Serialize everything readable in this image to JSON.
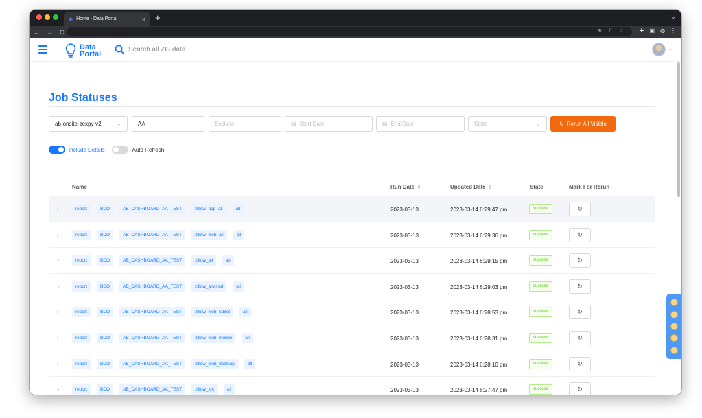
{
  "browser": {
    "tab_title": "Home - Data Portal",
    "new_tab": "+",
    "close": "×"
  },
  "app": {
    "logo_line1": "Data",
    "logo_line2": "Portal",
    "search_placeholder": "Search all ZG data"
  },
  "page": {
    "title": "Job Statuses"
  },
  "filters": {
    "experiment": "ab-onsite-zexpy-v2",
    "include": "AA",
    "exclude_placeholder": "Exclude",
    "start_placeholder": "Start Date",
    "end_placeholder": "End Date",
    "state_placeholder": "State",
    "rerun_all": "Rerun All Visible"
  },
  "toggles": {
    "include_details": "Include Details",
    "include_details_on": true,
    "auto_refresh": "Auto Refresh",
    "auto_refresh_on": false
  },
  "table": {
    "headers": {
      "name": "Name",
      "run_date": "Run Date",
      "updated_date": "Updated Date",
      "state": "State",
      "mark": "Mark For Rerun"
    },
    "rows": [
      {
        "t1": "report",
        "t2": "BDO",
        "t3": "AB_DASHBOARD_AA_TEST",
        "t4": "zillow_app_all",
        "t5": "all",
        "run": "2023-03-13",
        "updated": "2023-03-14 6:29:47 pm",
        "state": "success"
      },
      {
        "t1": "report",
        "t2": "BDO",
        "t3": "AB_DASHBOARD_AA_TEST",
        "t4": "zillow_web_all",
        "t5": "all",
        "run": "2023-03-13",
        "updated": "2023-03-14 6:29:36 pm",
        "state": "success"
      },
      {
        "t1": "report",
        "t2": "BDO",
        "t3": "AB_DASHBOARD_AA_TEST",
        "t4": "zillow_all",
        "t5": "all",
        "run": "2023-03-13",
        "updated": "2023-03-14 6:29:15 pm",
        "state": "success"
      },
      {
        "t1": "report",
        "t2": "BDO",
        "t3": "AB_DASHBOARD_AA_TEST",
        "t4": "zillow_android",
        "t5": "all",
        "run": "2023-03-13",
        "updated": "2023-03-14 6:29:03 pm",
        "state": "success"
      },
      {
        "t1": "report",
        "t2": "BDO",
        "t3": "AB_DASHBOARD_AA_TEST",
        "t4": "zillow_web_tablet",
        "t5": "all",
        "run": "2023-03-13",
        "updated": "2023-03-14 6:28:53 pm",
        "state": "success"
      },
      {
        "t1": "report",
        "t2": "BDO",
        "t3": "AB_DASHBOARD_AA_TEST",
        "t4": "zillow_web_mobile",
        "t5": "all",
        "run": "2023-03-13",
        "updated": "2023-03-14 6:28:31 pm",
        "state": "success"
      },
      {
        "t1": "report",
        "t2": "BDO",
        "t3": "AB_DASHBOARD_AA_TEST",
        "t4": "zillow_web_desktop",
        "t5": "all",
        "run": "2023-03-13",
        "updated": "2023-03-14 6:28:10 pm",
        "state": "success"
      },
      {
        "t1": "report",
        "t2": "BDO",
        "t3": "AB_DASHBOARD_AA_TEST",
        "t4": "zillow_ios",
        "t5": "all",
        "run": "2023-03-13",
        "updated": "2023-03-14 6:27:47 pm",
        "state": "success"
      }
    ]
  }
}
